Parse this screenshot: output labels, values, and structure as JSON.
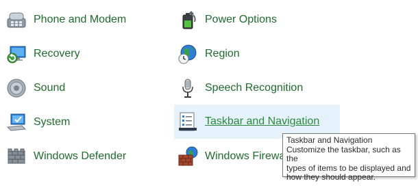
{
  "control_panel": {
    "left_column": [
      {
        "label": "Phone and Modem",
        "icon": "phone-modem-icon"
      },
      {
        "label": "Recovery",
        "icon": "recovery-icon"
      },
      {
        "label": "Sound",
        "icon": "speaker-icon"
      },
      {
        "label": "System",
        "icon": "system-computer-icon"
      },
      {
        "label": "Windows Defender",
        "icon": "defender-wall-icon"
      }
    ],
    "right_column": [
      {
        "label": "Power Options",
        "icon": "battery-plug-icon"
      },
      {
        "label": "Region",
        "icon": "globe-clock-icon"
      },
      {
        "label": "Speech Recognition",
        "icon": "microphone-icon"
      },
      {
        "label": "Taskbar and Navigation",
        "icon": "taskbar-checklist-icon"
      },
      {
        "label": "Windows Firewa",
        "icon": "firewall-globe-icon"
      }
    ]
  },
  "tooltip": {
    "title": "Taskbar and Navigation",
    "line1": "Customize the taskbar, such as the",
    "line2": "types of items to be displayed and",
    "line3": "how they should appear."
  },
  "colors": {
    "link_text": "#1e6b2d",
    "hover_background": "#e6f2fb"
  }
}
